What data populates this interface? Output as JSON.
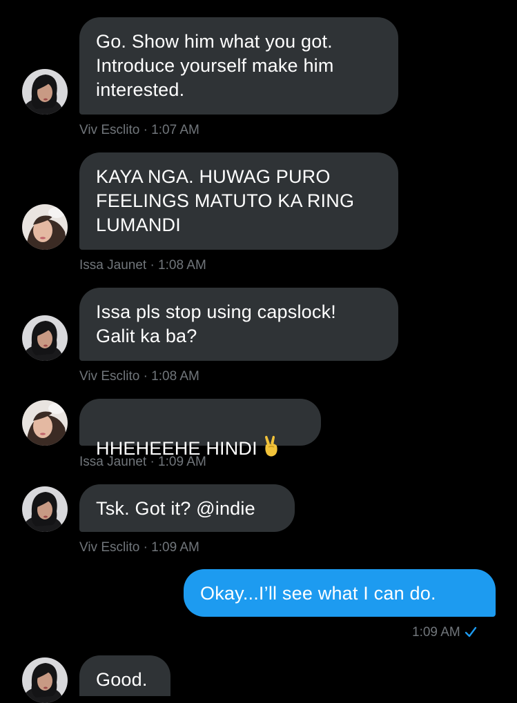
{
  "colors": {
    "background": "#000000",
    "received_bubble": "#2f3336",
    "sent_bubble": "#1d9bf0",
    "meta_text": "#71767b",
    "read_check": "#1d9bf0"
  },
  "messages": [
    {
      "sender": "Viv Esclito",
      "text": "Go. Show him what you got.\nIntroduce yourself make him\ninterested.",
      "meta": "Viv Esclito · 1:07 AM",
      "avatar_icon": "viv-avatar"
    },
    {
      "sender": "Issa Jaunet",
      "text": "KAYA NGA. HUWAG PURO\nFEELINGS MATUTO KA RING\nLUMANDI",
      "meta": "Issa Jaunet · 1:08 AM",
      "avatar_icon": "issa-avatar"
    },
    {
      "sender": "Viv Esclito",
      "text": "Issa pls stop using capslock!\nGalit ka ba?",
      "meta": "Viv Esclito · 1:08 AM",
      "avatar_icon": "viv-avatar"
    },
    {
      "sender": "Issa Jaunet",
      "text": "HHEHEEHE HINDI",
      "emoji": "victory-hand-icon",
      "meta": "Issa Jaunet · 1:09 AM",
      "avatar_icon": "issa-avatar"
    },
    {
      "sender": "Viv Esclito",
      "text": "Tsk. Got it? @indie",
      "meta": "Viv Esclito · 1:09 AM",
      "avatar_icon": "viv-avatar"
    },
    {
      "sender": "me",
      "text": "Okay...I’ll see what I can do.",
      "meta": "1:09 AM",
      "status_icon": "read-check-icon"
    },
    {
      "sender": "Viv Esclito",
      "text": "Good.",
      "avatar_icon": "viv-avatar"
    }
  ]
}
